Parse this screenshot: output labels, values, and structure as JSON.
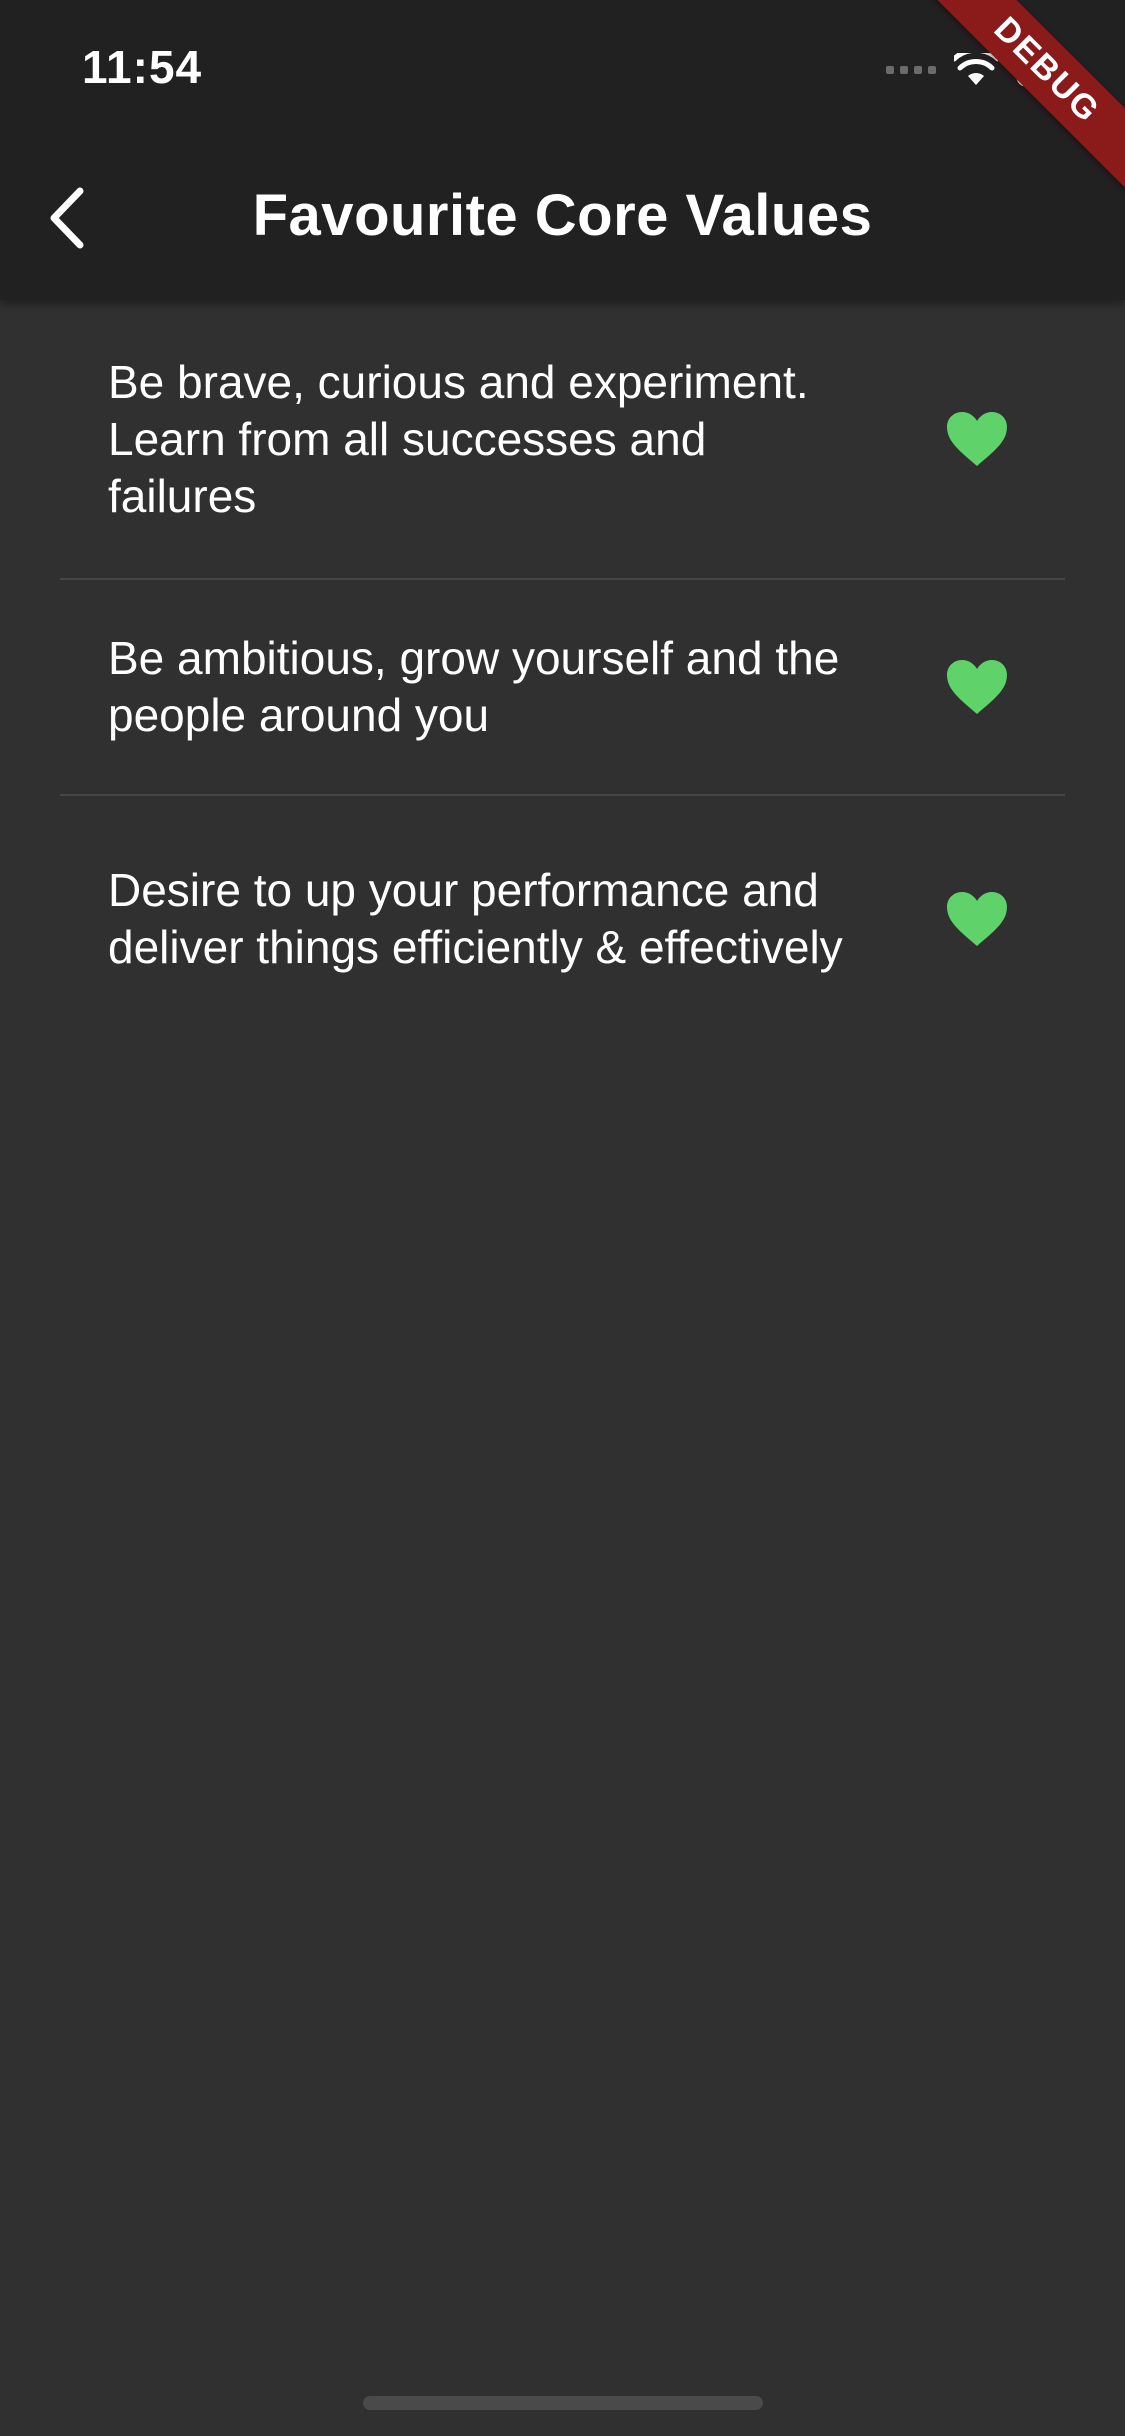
{
  "status_bar": {
    "time": "11:54"
  },
  "debug_banner": "DEBUG",
  "header": {
    "title": "Favourite Core Values",
    "back_icon": "chevron-left-icon"
  },
  "values": [
    {
      "text": "Be brave, curious and experiment. Learn from all successes and failures",
      "favourite": true
    },
    {
      "text": "Be ambitious, grow yourself and the people around you",
      "favourite": true
    },
    {
      "text": "Desire to up your performance and deliver things efficiently & effectively",
      "favourite": true
    }
  ],
  "colors": {
    "app_bar": "#212121",
    "background": "#303030",
    "heart": "#5fd36a",
    "debug_banner": "#8b1a1a"
  }
}
